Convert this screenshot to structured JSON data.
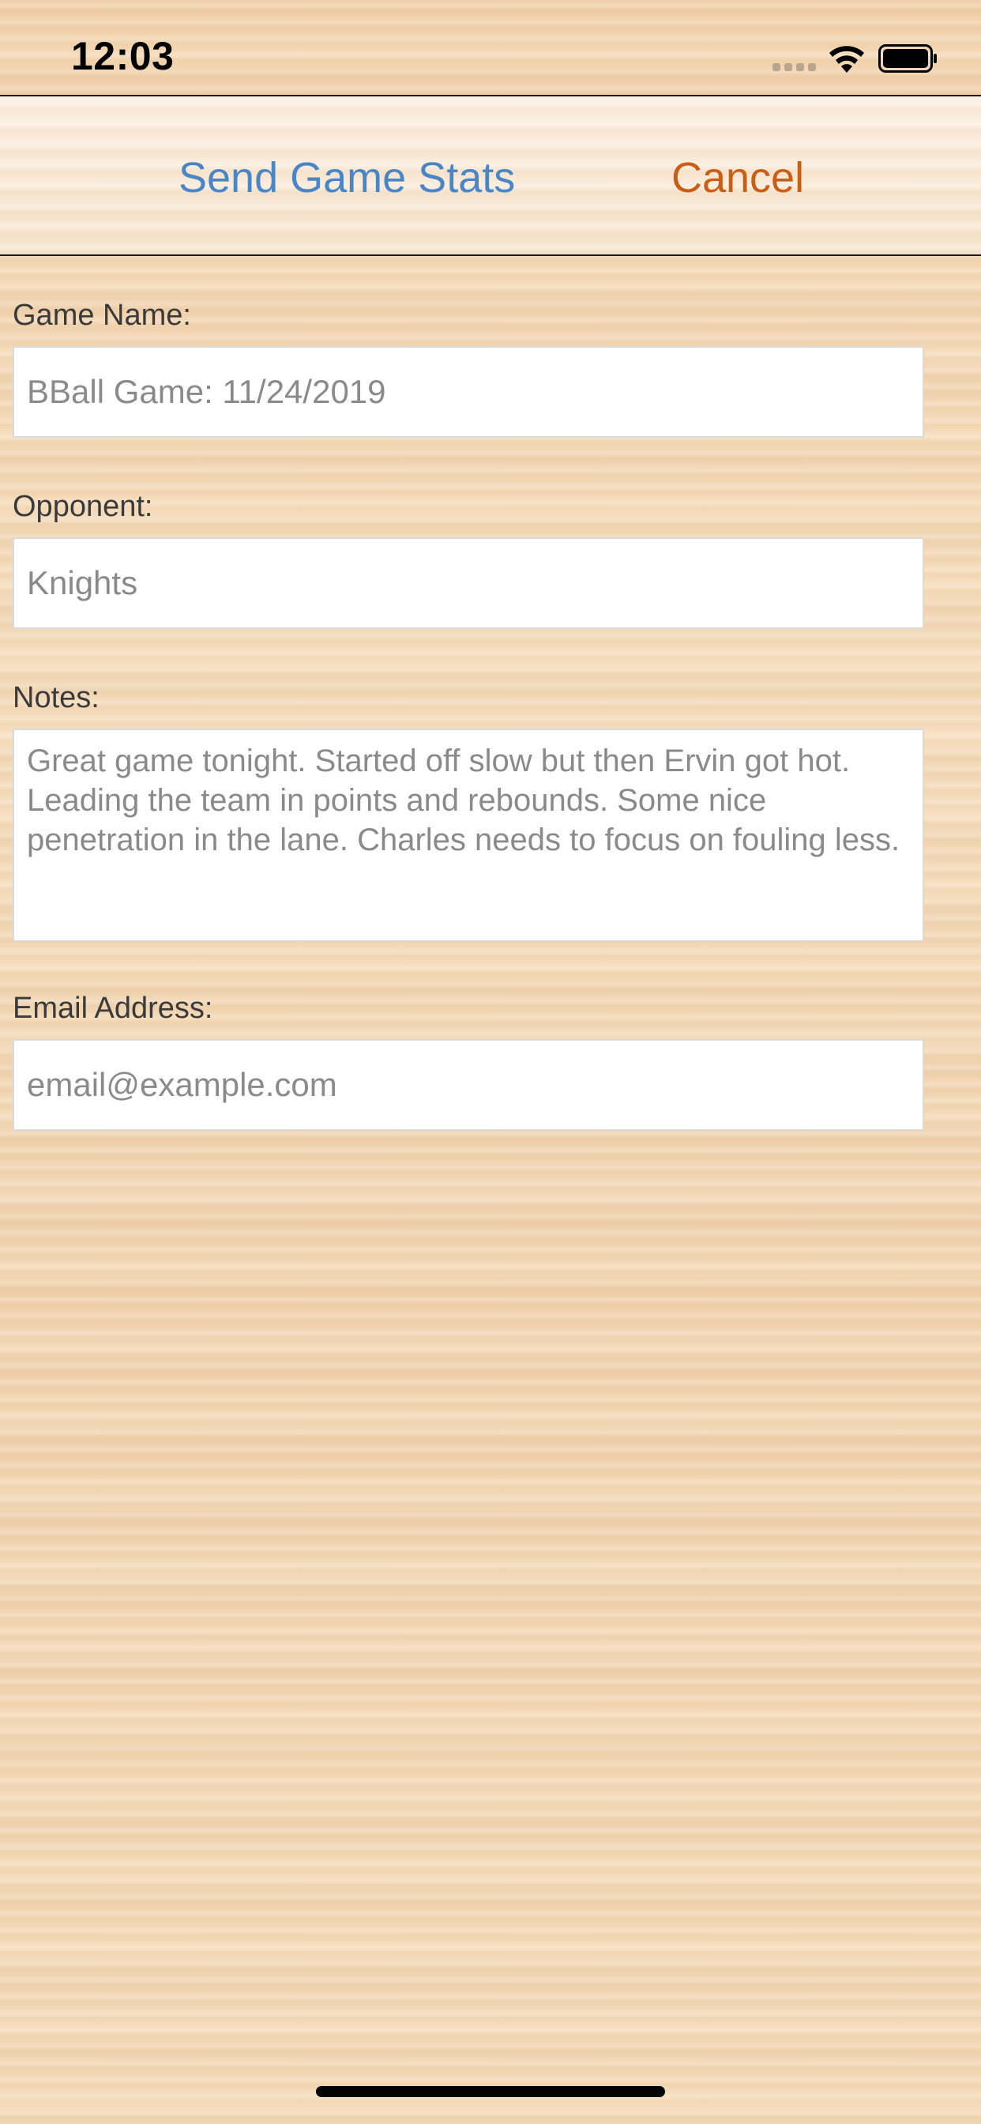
{
  "status_bar": {
    "time": "12:03",
    "icons": [
      "signal-icon",
      "wifi-icon",
      "battery-icon"
    ]
  },
  "nav": {
    "send_label": "Send Game Stats",
    "cancel_label": "Cancel"
  },
  "form": {
    "game_name": {
      "label": "Game Name:",
      "value": "BBall Game: 11/24/2019"
    },
    "opponent": {
      "label": "Opponent:",
      "value": "Knights"
    },
    "notes": {
      "label": "Notes:",
      "value": "Great game tonight. Started off slow but then Ervin got hot. Leading the team in points and rebounds. Some nice penetration in the lane. Charles needs to focus on fouling less."
    },
    "email": {
      "label": "Email Address:",
      "placeholder": "email@example.com"
    }
  },
  "colors": {
    "send_button": "#4a86c5",
    "cancel_button": "#c95f17",
    "background": "#f3d9b6"
  }
}
